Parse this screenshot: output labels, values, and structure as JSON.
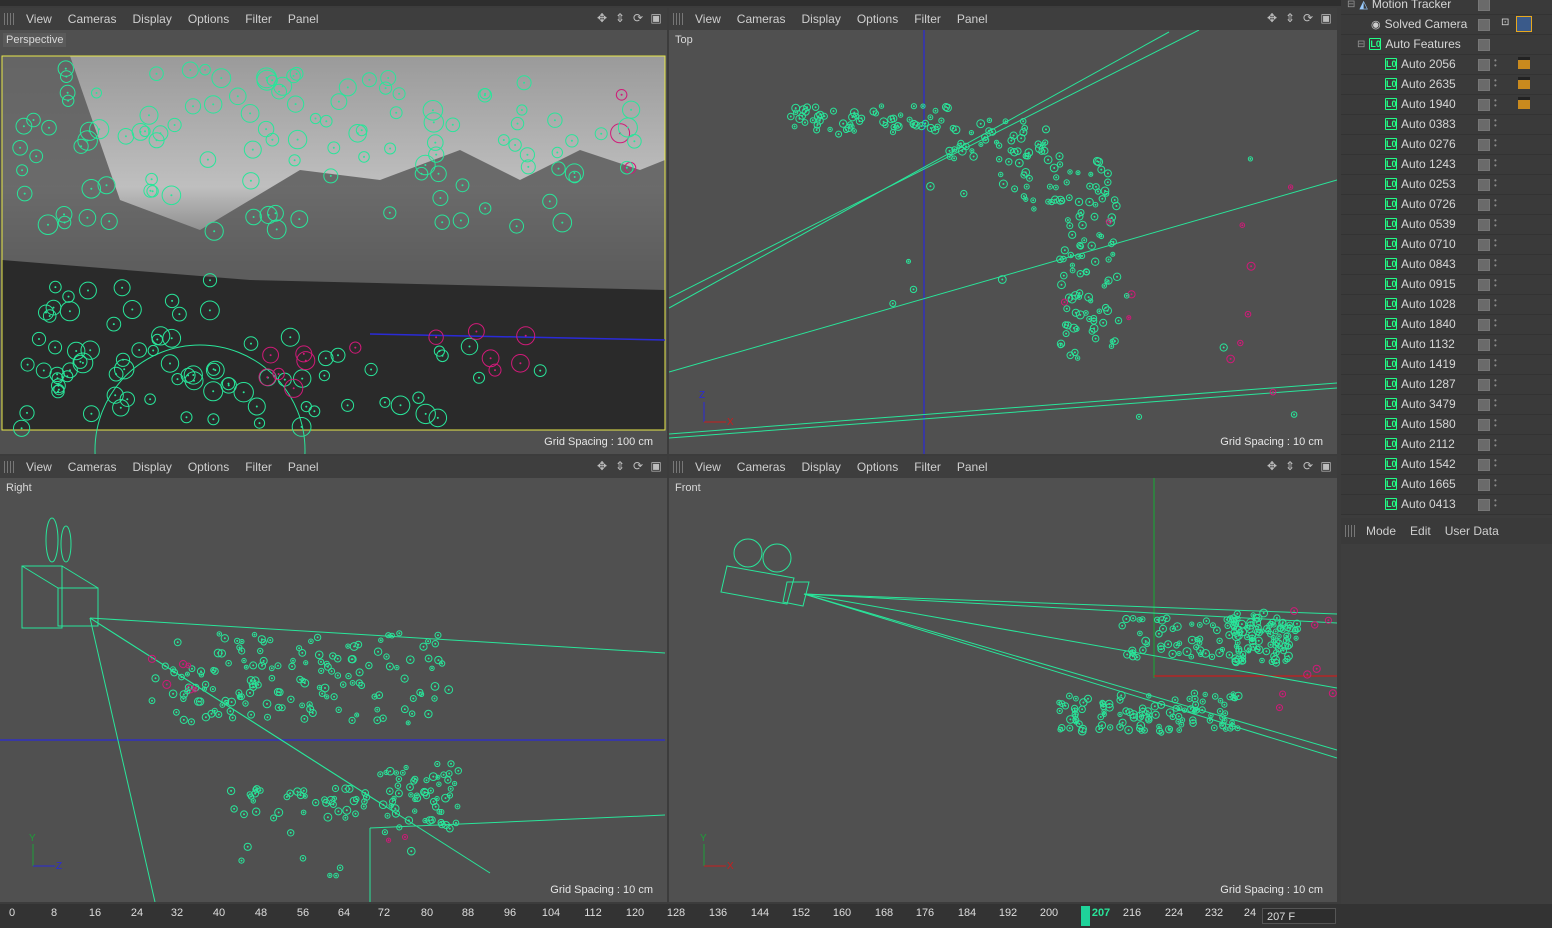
{
  "viewport_menu": [
    "View",
    "Cameras",
    "Display",
    "Options",
    "Filter",
    "Panel"
  ],
  "viewports": {
    "perspective": {
      "label": "Perspective",
      "grid": "Grid Spacing : 100 cm"
    },
    "top": {
      "label": "Top",
      "grid": "Grid Spacing : 10 cm"
    },
    "right": {
      "label": "Right",
      "grid": "Grid Spacing : 10 cm"
    },
    "front": {
      "label": "Front",
      "grid": "Grid Spacing : 10 cm"
    }
  },
  "object_manager": {
    "motion_tracker": "Motion Tracker",
    "solved_camera": "Solved Camera",
    "auto_features": "Auto Features",
    "features": [
      "Auto 2056",
      "Auto 2635",
      "Auto 1940",
      "Auto 0383",
      "Auto 0276",
      "Auto 1243",
      "Auto 0253",
      "Auto 0726",
      "Auto 0539",
      "Auto 0710",
      "Auto 0843",
      "Auto 0915",
      "Auto 1028",
      "Auto 1840",
      "Auto 1132",
      "Auto 1419",
      "Auto 1287",
      "Auto 3479",
      "Auto 1580",
      "Auto 2112",
      "Auto 1542",
      "Auto 1665",
      "Auto 0413"
    ]
  },
  "attributes_menu": [
    "Mode",
    "Edit",
    "User Data"
  ],
  "timeline": {
    "ticks": [
      "0",
      "8",
      "16",
      "24",
      "32",
      "40",
      "48",
      "56",
      "64",
      "72",
      "80",
      "88",
      "96",
      "104",
      "112",
      "120",
      "128",
      "136",
      "144",
      "152",
      "160",
      "168",
      "176",
      "184",
      "192",
      "200",
      "207",
      "216",
      "224",
      "232",
      "24"
    ],
    "current_frame": "207",
    "frame_field": "207 F"
  },
  "colors": {
    "track_green": "#29e59a",
    "track_magenta": "#d01a78",
    "axis_blue": "#2a2ad8",
    "axis_red": "#c81e1e",
    "axis_green": "#1e9e3a",
    "viewport_bg": "#505050"
  }
}
